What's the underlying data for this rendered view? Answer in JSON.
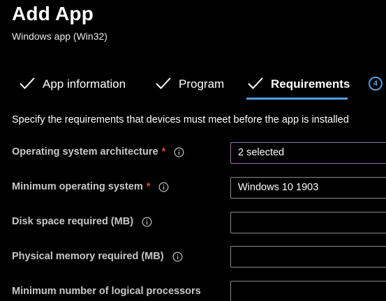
{
  "header": {
    "title": "Add App",
    "subtitle": "Windows app (Win32)"
  },
  "tabs": [
    {
      "label": "App information",
      "state": "completed"
    },
    {
      "label": "Program",
      "state": "completed"
    },
    {
      "label": "Requirements",
      "state": "active"
    }
  ],
  "next_step": {
    "number": "4"
  },
  "description": "Specify the requirements that devices must meet before the app is installed",
  "fields": {
    "os_architecture": {
      "label": "Operating system architecture",
      "required": "*",
      "value": "2 selected"
    },
    "min_os": {
      "label": "Minimum operating system",
      "required": "*",
      "value": "Windows 10 1903"
    },
    "disk_space": {
      "label": "Disk space required (MB)",
      "value": ""
    },
    "physical_memory": {
      "label": "Physical memory required (MB)",
      "value": ""
    },
    "logical_processors": {
      "label": "Minimum number of logical processors",
      "value": ""
    }
  },
  "colors": {
    "background": "#000000",
    "accent": "#4f9fe0",
    "required": "#e3462f",
    "dropdown_border": "#9b6fb3"
  },
  "icons": {
    "tab_check": "checkmark-icon",
    "field_info": "info-icon"
  }
}
